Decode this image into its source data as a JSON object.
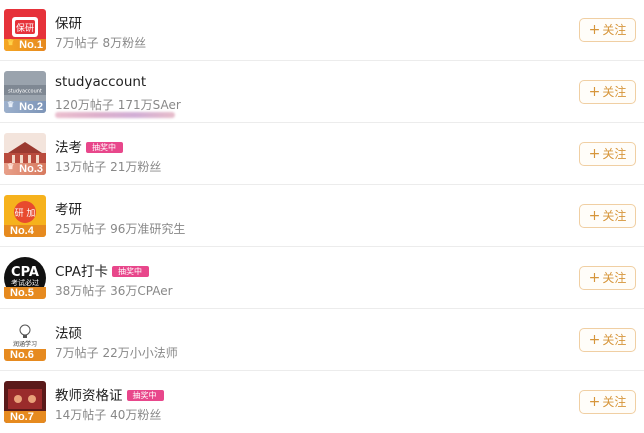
{
  "list": {
    "items": [
      {
        "rank": "No.1",
        "name": "保研",
        "posts": "7万帖子",
        "fans": "8万粉丝",
        "badge": "",
        "avatar_text": "保研",
        "follow": "关注"
      },
      {
        "rank": "No.2",
        "name": "studyaccount",
        "posts": "120万帖子",
        "fans": "171万SAer",
        "badge": "",
        "avatar_text": "studyaccount",
        "follow": "关注"
      },
      {
        "rank": "No.3",
        "name": "法考",
        "posts": "13万帖子",
        "fans": "21万粉丝",
        "badge": "抽奖中",
        "avatar_text": "",
        "follow": "关注"
      },
      {
        "rank": "No.4",
        "name": "考研",
        "posts": "25万帖子",
        "fans": "96万准研究生",
        "badge": "",
        "avatar_text": "研 加",
        "follow": "关注"
      },
      {
        "rank": "No.5",
        "name": "CPA打卡",
        "posts": "38万帖子",
        "fans": "36万CPAer",
        "badge": "抽奖中",
        "avatar_text": "CPA",
        "avatar_sub": "考试必过",
        "follow": "关注"
      },
      {
        "rank": "No.6",
        "name": "法硕",
        "posts": "7万帖子",
        "fans": "22万小小法师",
        "badge": "",
        "avatar_text": "润涵学习",
        "follow": "关注"
      },
      {
        "rank": "No.7",
        "name": "教师资格证",
        "posts": "14万帖子",
        "fans": "40万粉丝",
        "badge": "抽奖中",
        "avatar_text": "",
        "follow": "关注"
      }
    ]
  },
  "colors": {
    "accent": "#d6953a",
    "badge": "#e8478b",
    "rank_gold": "#f5a623",
    "rank_silver": "#9cb0cc",
    "rank_bronze": "#d77a5e"
  }
}
